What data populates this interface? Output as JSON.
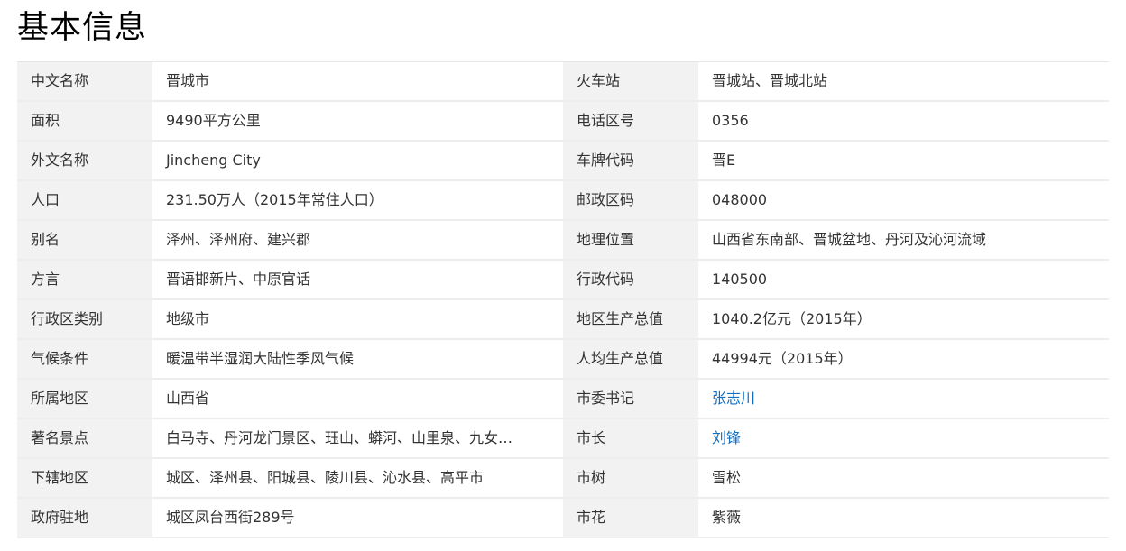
{
  "title": "基本信息",
  "rows": [
    {
      "left_label": "中文名称",
      "left_value": "晋城市",
      "right_label": "火车站",
      "right_value": "晋城站、晋城北站"
    },
    {
      "left_label": "面积",
      "left_value": "9490平方公里",
      "right_label": "电话区号",
      "right_value": "0356"
    },
    {
      "left_label": "外文名称",
      "left_value": "Jincheng City",
      "right_label": "车牌代码",
      "right_value": "晋E"
    },
    {
      "left_label": "人口",
      "left_value": "231.50万人（2015年常住人口）",
      "right_label": "邮政区码",
      "right_value": "048000"
    },
    {
      "left_label": "别名",
      "left_value": "泽州、泽州府、建兴郡",
      "right_label": "地理位置",
      "right_value": "山西省东南部、晋城盆地、丹河及沁河流域"
    },
    {
      "left_label": "方言",
      "left_value": "晋语邯新片、中原官话",
      "right_label": "行政代码",
      "right_value": "140500"
    },
    {
      "left_label": "行政区类别",
      "left_value": "地级市",
      "right_label": "地区生产总值",
      "right_value": "1040.2亿元（2015年）"
    },
    {
      "left_label": "气候条件",
      "left_value": "暖温带半湿润大陆性季风气候",
      "right_label": "人均生产总值",
      "right_value": "44994元（2015年）"
    },
    {
      "left_label": "所属地区",
      "left_value": "山西省",
      "right_label": "市委书记",
      "right_value": "张志川"
    },
    {
      "left_label": "著名景点",
      "left_value": "白马寺、丹河龙门景区、珏山、蟒河、山里泉、九女…",
      "right_label": "市长",
      "right_value": "刘锋"
    },
    {
      "left_label": "下辖地区",
      "left_value": "城区、泽州县、阳城县、陵川县、沁水县、高平市",
      "right_label": "市树",
      "right_value": "雪松"
    },
    {
      "left_label": "政府驻地",
      "left_value": "城区凤台西街289号",
      "right_label": "市花",
      "right_value": "紫薇"
    }
  ],
  "colors": {
    "label_bg": "#f2f2f2",
    "link": "#136ec2",
    "border": "#ededed"
  }
}
